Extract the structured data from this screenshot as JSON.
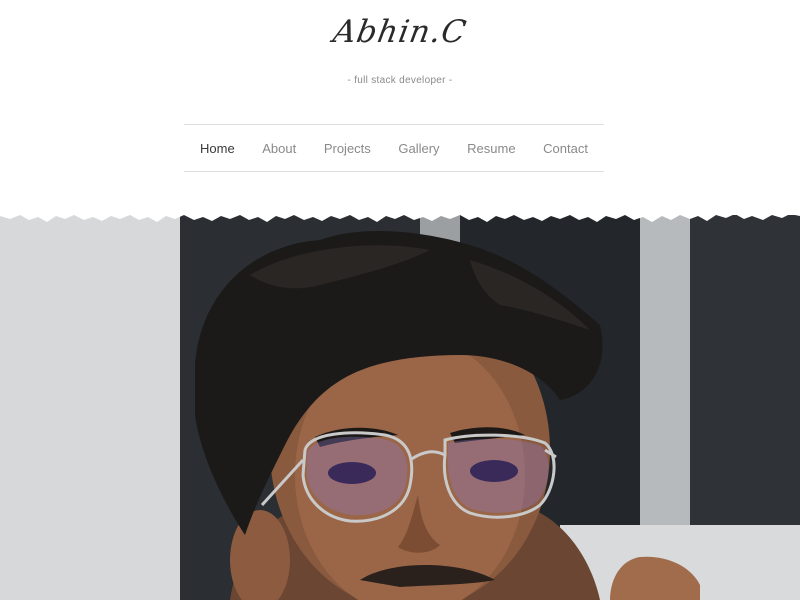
{
  "header": {
    "logo_text": "Abhin.C",
    "tagline": "- full stack developer -"
  },
  "nav": {
    "items": [
      {
        "label": "Home",
        "active": true
      },
      {
        "label": "About",
        "active": false
      },
      {
        "label": "Projects",
        "active": false
      },
      {
        "label": "Gallery",
        "active": false
      },
      {
        "label": "Resume",
        "active": false
      },
      {
        "label": "Contact",
        "active": false
      }
    ]
  },
  "colors": {
    "text_dark": "#2a2a2a",
    "text_muted": "#8a8a8a",
    "divider": "#dedede"
  }
}
